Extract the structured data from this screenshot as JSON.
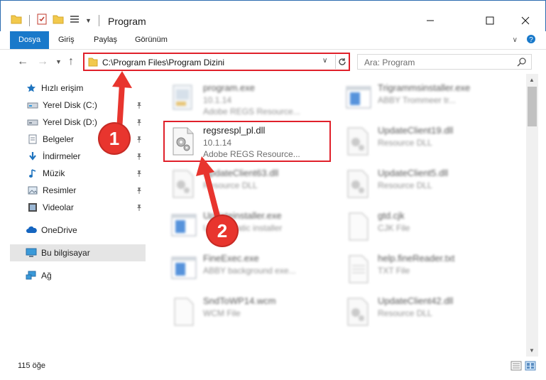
{
  "window": {
    "title": "Program",
    "border_color": "#2b6cb0"
  },
  "ribbon": {
    "tabs": [
      "Dosya",
      "Giriş",
      "Paylaş",
      "Görünüm"
    ],
    "accent": "#1979ca"
  },
  "address": {
    "path": "C:\\Program Files\\Program Dizini",
    "highlight_color": "#e0202a"
  },
  "search": {
    "placeholder": "Ara: Program"
  },
  "sidebar": {
    "items": [
      {
        "label": "Hızlı erişim",
        "icon": "star-icon",
        "pinned": false
      },
      {
        "label": "Yerel Disk (C:)",
        "icon": "drive-icon",
        "pinned": true
      },
      {
        "label": "Yerel Disk (D:)",
        "icon": "drive-icon",
        "pinned": true
      },
      {
        "label": "Belgeler",
        "icon": "documents-icon",
        "pinned": true
      },
      {
        "label": "İndirmeler",
        "icon": "download-icon",
        "pinned": true
      },
      {
        "label": "Müzik",
        "icon": "music-icon",
        "pinned": true
      },
      {
        "label": "Resimler",
        "icon": "pictures-icon",
        "pinned": true
      },
      {
        "label": "Videolar",
        "icon": "video-icon",
        "pinned": true
      },
      {
        "label": "OneDrive",
        "icon": "cloud-icon",
        "pinned": false
      },
      {
        "label": "Bu bilgisayar",
        "icon": "computer-icon",
        "pinned": false
      },
      {
        "label": "Ağ",
        "icon": "network-icon",
        "pinned": false
      }
    ]
  },
  "files": [
    {
      "name": "program.exe",
      "line2": "10.1.14",
      "line3": "Adobe REGS Resource...",
      "icon": "exe-icon"
    },
    {
      "name": "Trigrammsinstaller.exe",
      "line2": "ABBY Trommeer tr...",
      "line3": "",
      "icon": "exe-window-icon"
    },
    {
      "name": "regsrespl_pl.dll",
      "line2": "10.1.14",
      "line3": "Adobe REGS Resource...",
      "icon": "dll-gear-icon"
    },
    {
      "name": "UpdateClient19.dll",
      "line2": "Resource DLL",
      "line3": "",
      "icon": "dll-gear-icon"
    },
    {
      "name": "UpdateClient63.dll",
      "line2": "Resource DLL",
      "line3": "",
      "icon": "dll-gear-icon"
    },
    {
      "name": "UpdateClient5.dll",
      "line2": "Resource DLL",
      "line3": "",
      "icon": "dll-gear-icon"
    },
    {
      "name": "Updateinstaller.exe",
      "line2": "Updatestatic installer",
      "line3": "",
      "icon": "exe-window-icon"
    },
    {
      "name": "gtd.cjk",
      "line2": "CJK File",
      "line3": "",
      "icon": "blank-file-icon"
    },
    {
      "name": "FineExec.exe",
      "line2": "ABBY background exe...",
      "line3": "",
      "icon": "exe-window-icon"
    },
    {
      "name": "help.fineReader.txt",
      "line2": "TXT File",
      "line3": "",
      "icon": "text-file-icon"
    },
    {
      "name": "SndToWP14.wcm",
      "line2": "WCM File",
      "line3": "",
      "icon": "blank-file-icon"
    },
    {
      "name": "UpdateClient42.dll",
      "line2": "Resource DLL",
      "line3": "",
      "icon": "dll-gear-icon"
    }
  ],
  "selected_file_index": 2,
  "status": {
    "count": "115 öğe"
  },
  "annotations": {
    "step1": "1",
    "step2": "2",
    "color": "#e8352e"
  }
}
